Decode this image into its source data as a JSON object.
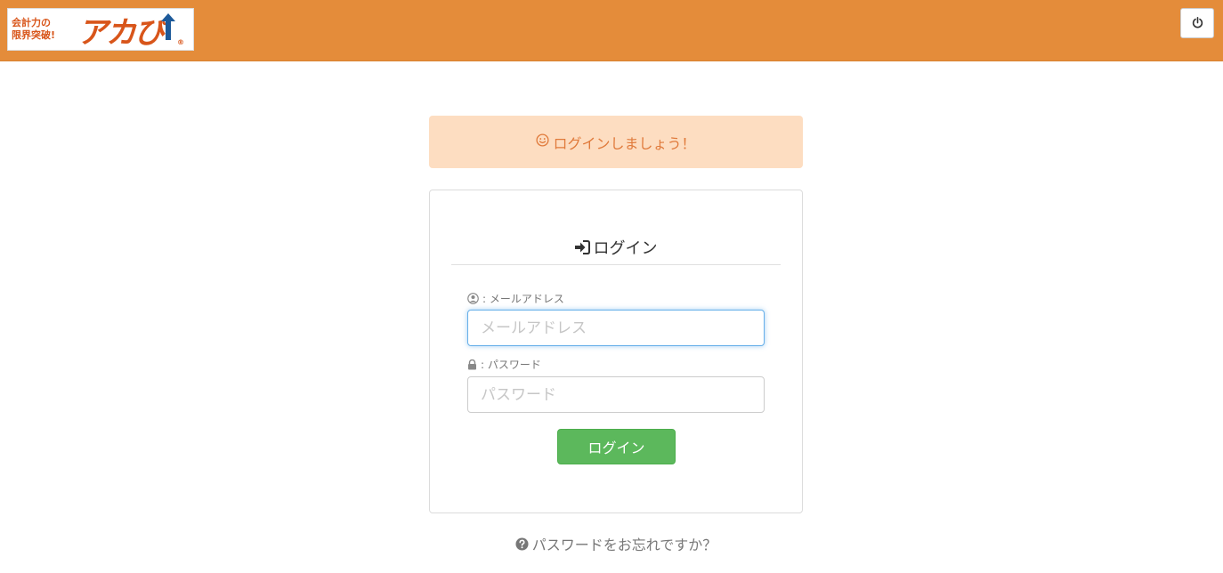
{
  "header": {
    "logo_tagline_line1": "会計力の",
    "logo_tagline_line2": "限界突破!",
    "logo_brand": "アカ",
    "logo_brand_tail": "ぴ",
    "logo_reg": "®",
    "power_icon": "power-icon",
    "background_color": "#e48c3a"
  },
  "alert": {
    "icon": "smile-icon",
    "text": "ログインしましょう！",
    "background_color": "#fdddc1",
    "text_color": "#e07a3b"
  },
  "login_panel": {
    "title_icon": "sign-in-icon",
    "title": "ログイン",
    "email": {
      "icon": "user-circle-icon",
      "label": " : メールアドレス",
      "placeholder": "メールアドレス",
      "value": ""
    },
    "password": {
      "icon": "lock-icon",
      "label": " : パスワード",
      "placeholder": "パスワード",
      "value": ""
    },
    "submit_label": "ログイン",
    "submit_color": "#5cb85c"
  },
  "forgot": {
    "icon": "question-circle-icon",
    "text": "パスワードをお忘れですか？"
  }
}
